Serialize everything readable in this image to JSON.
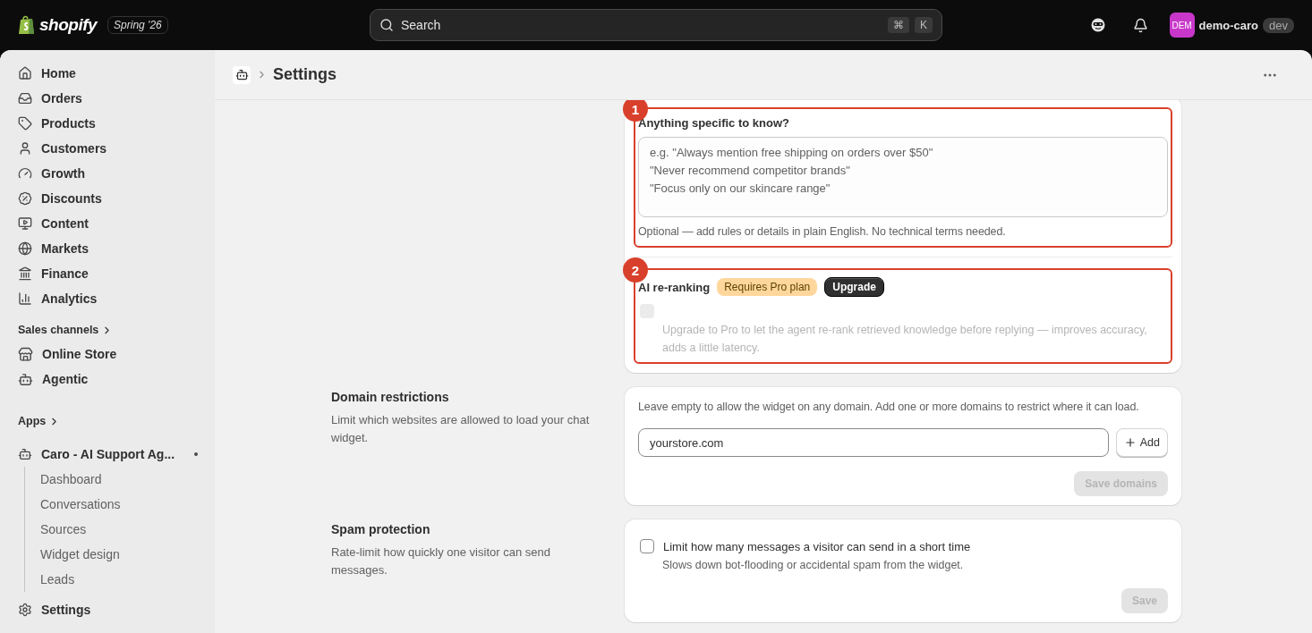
{
  "topbar": {
    "brand": "shopify",
    "release_badge": "Spring '26",
    "search": {
      "placeholder": "Search",
      "shortcut": [
        "⌘",
        "K"
      ]
    },
    "avatar_initials": "DEM",
    "store_name": "demo-caro",
    "store_badge": "dev"
  },
  "sidebar": {
    "items": [
      {
        "label": "Home"
      },
      {
        "label": "Orders"
      },
      {
        "label": "Products"
      },
      {
        "label": "Customers"
      },
      {
        "label": "Growth"
      },
      {
        "label": "Discounts"
      },
      {
        "label": "Content"
      },
      {
        "label": "Markets"
      },
      {
        "label": "Finance"
      },
      {
        "label": "Analytics"
      }
    ],
    "sales_channels": {
      "heading": "Sales channels",
      "items": [
        {
          "label": "Online Store"
        },
        {
          "label": "Agentic"
        }
      ]
    },
    "apps": {
      "heading": "Apps",
      "app": {
        "label": "Caro - AI Support Ag...",
        "unread": true,
        "children": [
          {
            "label": "Dashboard"
          },
          {
            "label": "Conversations"
          },
          {
            "label": "Sources"
          },
          {
            "label": "Widget design"
          },
          {
            "label": "Leads"
          }
        ]
      }
    },
    "footer": {
      "label": "Settings"
    }
  },
  "page": {
    "title": "Settings"
  },
  "sections": [
    {
      "card": {
        "groups": [
          {
            "kind": "textarea",
            "badge": "1",
            "title": "Anything specific to know?",
            "placeholder": "e.g. \"Always mention free shipping on orders over $50\"\n\"Never recommend competitor brands\"\n\"Focus only on our skincare range\"",
            "help": "Optional — add rules or details in plain English. No technical terms needed."
          },
          {
            "kind": "checkbox",
            "badge": "2",
            "title": "AI re-ranking",
            "tag": "Requires Pro plan",
            "button": "Upgrade",
            "checked": false,
            "disabled": true,
            "description": "Upgrade to Pro to let the agent re-rank retrieved knowledge before replying — improves accuracy, adds a little latency."
          }
        ]
      }
    },
    {
      "heading": "Domain restrictions",
      "description": "Limit which websites are allowed to load your chat widget.",
      "card": {
        "kind": "domains",
        "help": "Leave empty to allow the widget on any domain. Add one or more domains to restrict where it can load.",
        "placeholder": "yourstore.com",
        "add_button": "Add",
        "save_button": {
          "label": "Save domains",
          "disabled": true
        }
      }
    },
    {
      "heading": "Spam protection",
      "description": "Rate-limit how quickly one visitor can send messages.",
      "card": {
        "kind": "spam",
        "checkbox": {
          "label": "Limit how many messages a visitor can send in a short time",
          "checked": false,
          "disabled": false
        },
        "hint": "Slows down bot-flooding or accidental spam from the widget.",
        "save_button": {
          "label": "Save",
          "disabled": true
        }
      }
    }
  ]
}
